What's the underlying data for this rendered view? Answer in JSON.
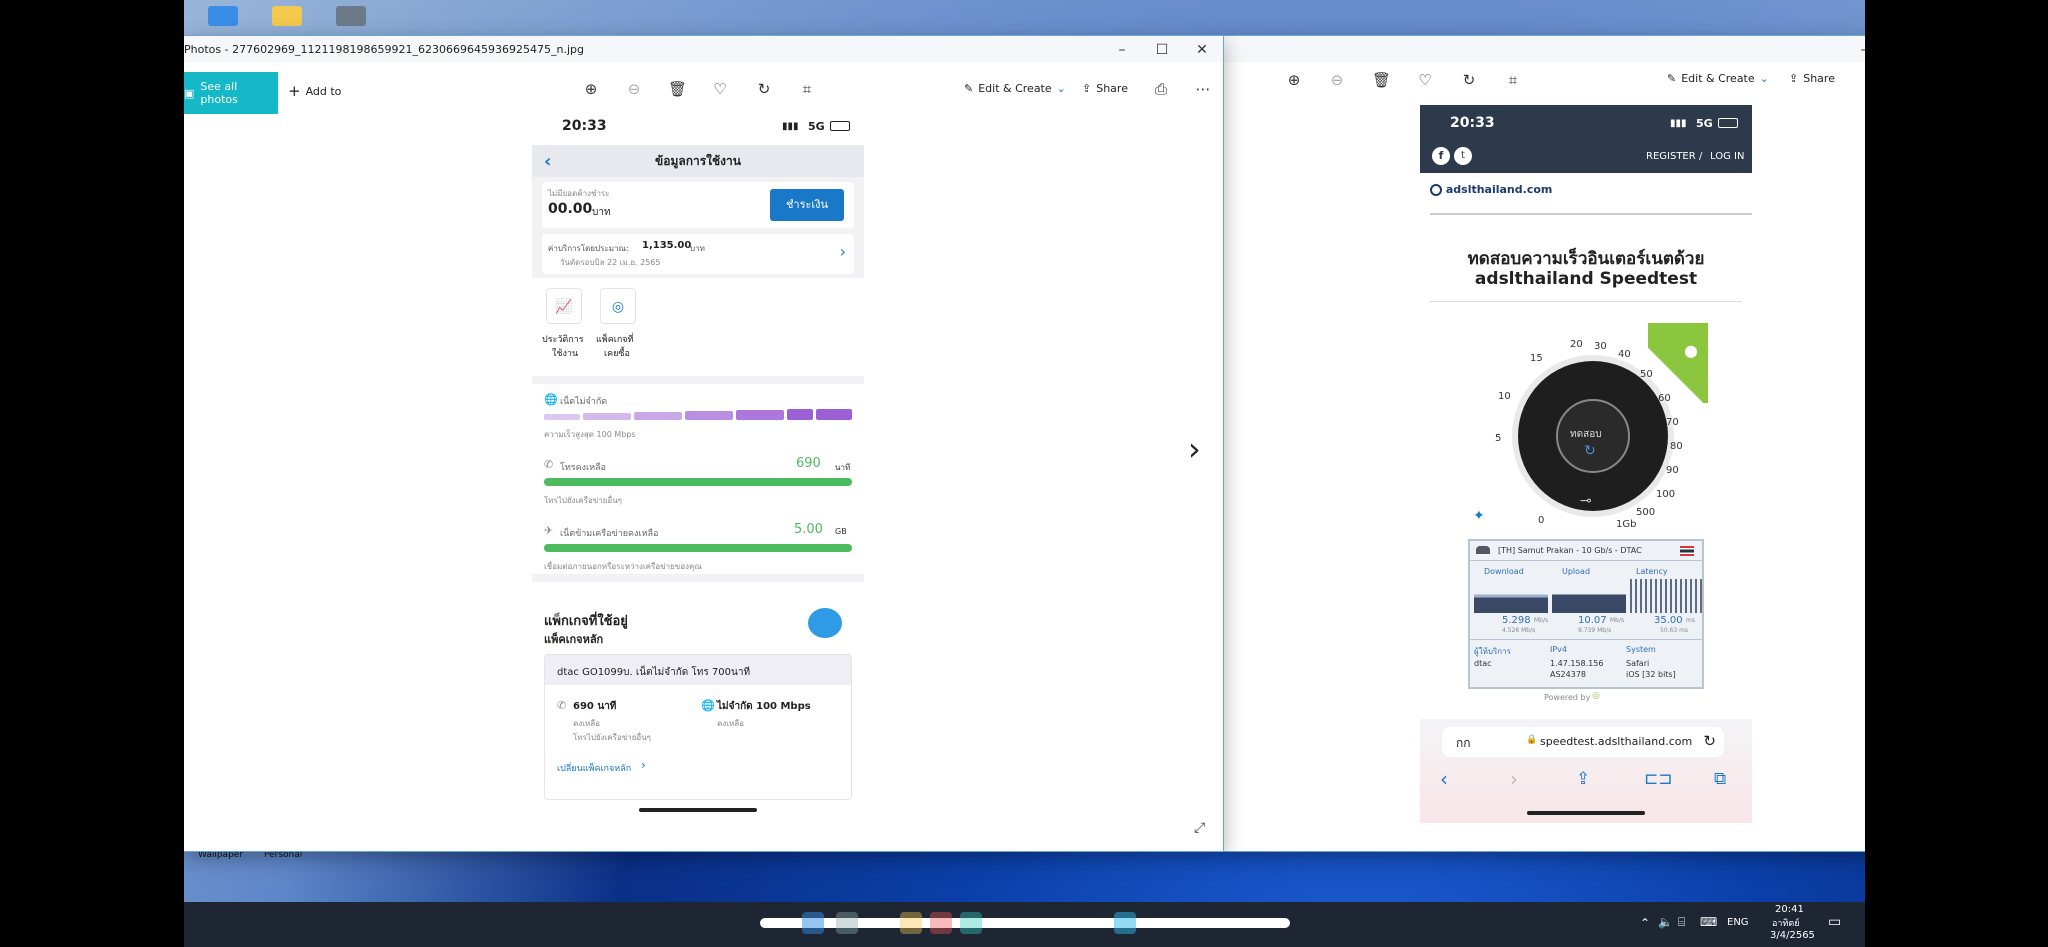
{
  "desktop": {
    "bottom_labels": [
      "Wallpaper",
      "Personal"
    ]
  },
  "photos_window": {
    "title": "Photos - 277602969_1121198198659921_6230669645936925475_n.jpg",
    "see_all": "See all photos",
    "add_to": "Add to",
    "edit_create": "Edit & Create",
    "share": "Share"
  },
  "phone_left": {
    "time": "20:33",
    "network": "5G",
    "header_title": "ข้อมูลการใช้งาน",
    "balance_label": "ไม่มียอดค้างชำระ",
    "balance_value": "00.00",
    "balance_unit": "บาท",
    "pay_button": "ชำระเงิน",
    "service_label": "ค่าบริการโดยประมาณ:",
    "service_value": "1,135.00",
    "service_unit": "บาท",
    "bill_date": "วันตัดรอบบิล 22 เม.ย. 2565",
    "shortcut_1_line1": "ประวัติการ",
    "shortcut_1_line2": "ใช้งาน",
    "shortcut_2_line1": "แพ็คเกจที่",
    "shortcut_2_line2": "เคยซื้อ",
    "net_title": "เน็ตไม่จำกัด",
    "net_sub": "ความเร็วสูงสุด 100 Mbps",
    "call_title": "โทรคงเหลือ",
    "call_value": "690",
    "call_unit": "นาที",
    "call_sub": "โทรไปยังเครือข่ายอื่นๆ",
    "roam_title": "เน็ตข้ามเครือข่ายคงเหลือ",
    "roam_value": "5.00",
    "roam_unit": "GB",
    "roam_sub": "เชื่อมต่อภายนอกหรือระหว่างเครือข่ายของคุณ",
    "pkg_title": "แพ็กเกจที่ใช้อยู่",
    "pkg_sub": "แพ็คเกจหลัก",
    "pkg_name": "dtac GO1099บ. เน็ตไม่จำกัด โทร 700นาที",
    "pkg_call": "690 นาที",
    "pkg_call_sub1": "คงเหลือ",
    "pkg_call_sub2": "โทรไปยังเครือข่ายอื่นๆ",
    "pkg_net": "ไม่จำกัด 100 Mbps",
    "pkg_net_sub": "คงเหลือ",
    "pkg_change": "เปลี่ยนแพ็คเกจหลัก"
  },
  "phone_right": {
    "time": "20:33",
    "network": "5G",
    "register": "REGISTER",
    "slash": "/",
    "login": "LOG IN",
    "site_logo": "adslthailand.com",
    "headline_1": "ทดสอบความเร็วอินเตอร์เนตด้วย",
    "headline_2": "adslthailand Speedtest",
    "gauge_labels": [
      "0",
      "5",
      "10",
      "15",
      "20",
      "30",
      "40",
      "50",
      "60",
      "70",
      "80",
      "90",
      "100",
      "500",
      "1Gb"
    ],
    "gauge_center": "ทดสอบ",
    "server": "[TH] Samut Prakan - 10 Gb/s - DTAC",
    "col_download": "Download",
    "col_upload": "Upload",
    "col_latency": "Latency",
    "dl_value": "5.298",
    "dl_unit": "Mb/s",
    "dl_avg": "4.526 Mb/s",
    "ul_value": "10.07",
    "ul_unit": "Mb/s",
    "ul_avg": "9.739 Mb/s",
    "lat_value": "35.00",
    "lat_unit": "ms",
    "lat_avg": "50.63 ms",
    "isp_label": "ผู้ให้บริการ",
    "isp_value": "dtac",
    "ip_label": "IPv4",
    "ip_value": "1.47.158.156",
    "as_value": "AS24378",
    "sys_label": "System",
    "sys_value1": "Safari",
    "sys_value2": "iOS [32 bits]",
    "powered": "Powered by",
    "url_font": "กก",
    "url": "speedtest.adslthailand.com"
  },
  "tray": {
    "lang": "ENG",
    "time": "20:41",
    "day": "อาทิตย์",
    "date": "3/4/2565"
  },
  "colors": {
    "accent": "#14b8c7",
    "dtac_blue": "#1a78c9",
    "green": "#4cbb5f",
    "purple": "#9d5fd6",
    "dark_header": "#2d3a4c"
  }
}
